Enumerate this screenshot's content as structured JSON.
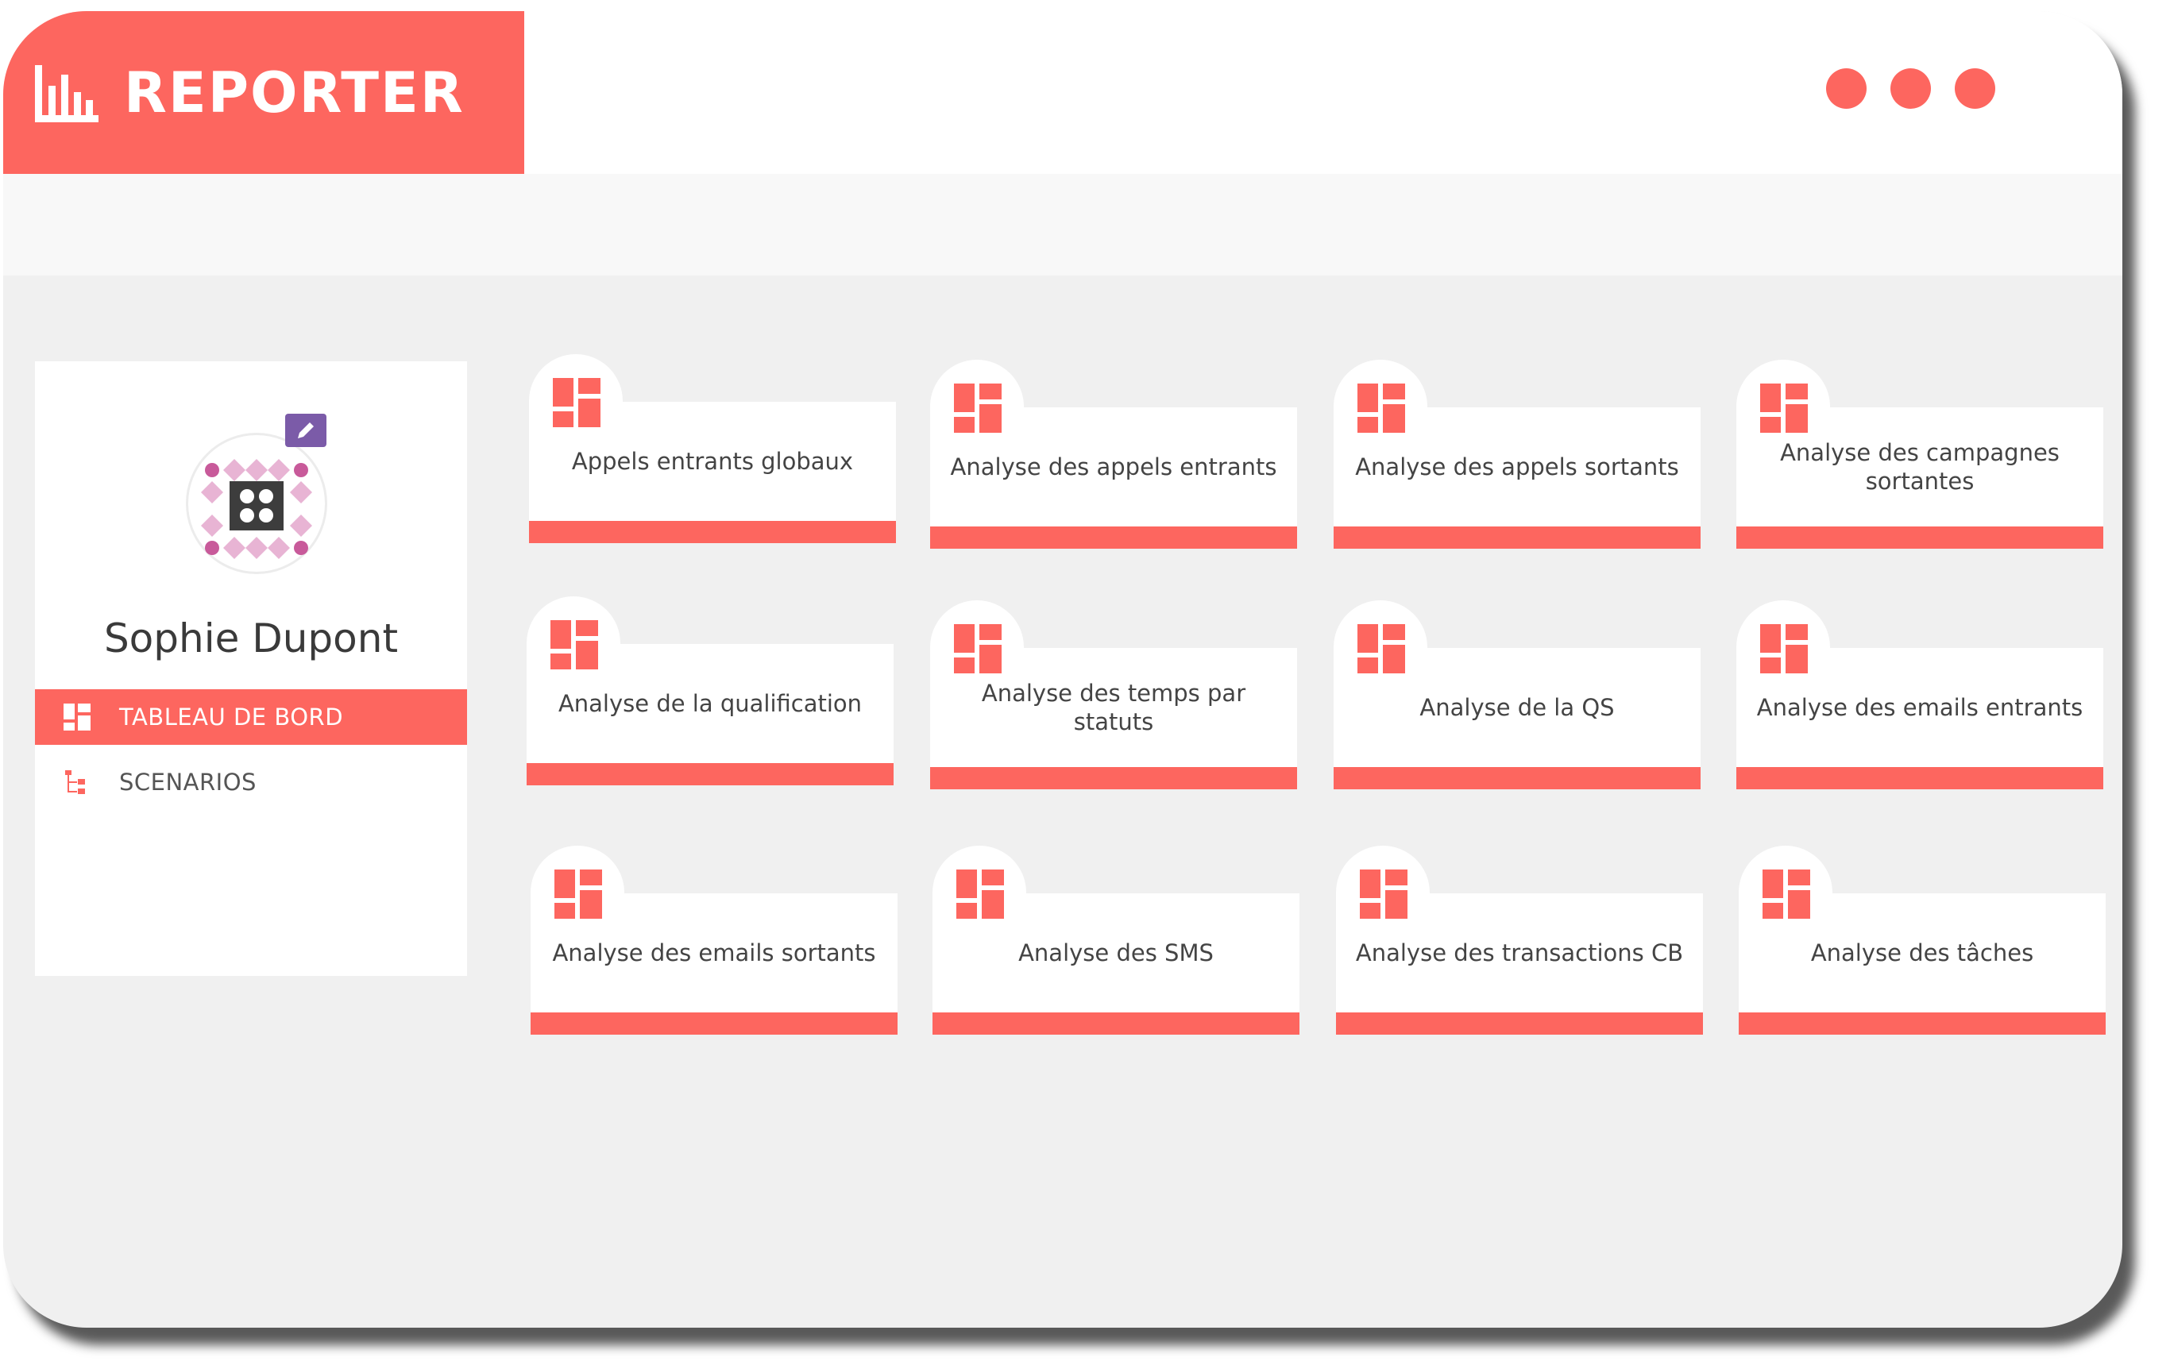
{
  "app": {
    "title": "REPORTER",
    "brand_icon": "bar-chart-icon",
    "accent_color": "#fd665f"
  },
  "window_controls": [
    "dot",
    "dot",
    "dot"
  ],
  "profile": {
    "user_name": "Sophie Dupont",
    "avatar_icon": "avatar-pattern-icon",
    "edit_icon": "pencil-icon"
  },
  "nav": {
    "items": [
      {
        "label": "TABLEAU DE BORD",
        "icon": "dashboard-icon",
        "active": true
      },
      {
        "label": "SCENARIOS",
        "icon": "tree-icon",
        "active": false
      }
    ]
  },
  "cards": [
    {
      "label": "Appels entrants globaux",
      "icon": "dashboard-icon"
    },
    {
      "label": "Analyse des appels entrants",
      "icon": "dashboard-icon"
    },
    {
      "label": "Analyse des appels sortants",
      "icon": "dashboard-icon"
    },
    {
      "label": "Analyse des campagnes sortantes",
      "icon": "dashboard-icon"
    },
    {
      "label": "Analyse de la qualification",
      "icon": "dashboard-icon"
    },
    {
      "label": "Analyse des temps par statuts",
      "icon": "dashboard-icon"
    },
    {
      "label": "Analyse de la QS",
      "icon": "dashboard-icon"
    },
    {
      "label": "Analyse des emails entrants",
      "icon": "dashboard-icon"
    },
    {
      "label": "Analyse des emails sortants",
      "icon": "dashboard-icon"
    },
    {
      "label": "Analyse des SMS",
      "icon": "dashboard-icon"
    },
    {
      "label": "Analyse des transactions CB",
      "icon": "dashboard-icon"
    },
    {
      "label": "Analyse des tâches",
      "icon": "dashboard-icon"
    }
  ]
}
